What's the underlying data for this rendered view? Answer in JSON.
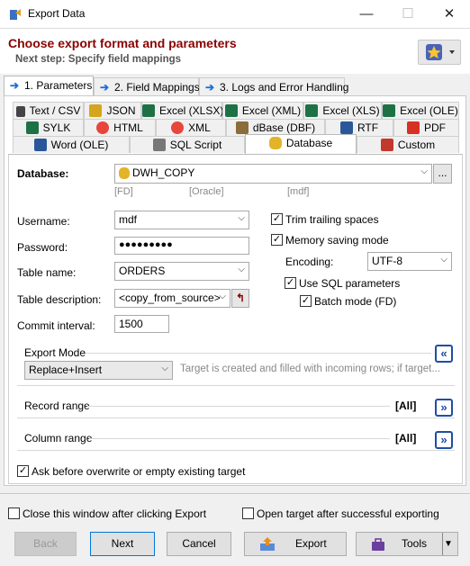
{
  "window": {
    "title": "Export Data",
    "minimize": "—",
    "maximize": "☐",
    "close": "✕"
  },
  "header": {
    "title": "Choose export format and parameters",
    "subtitle": "Next step: Specify field mappings"
  },
  "main_tabs": [
    {
      "label": "1. Parameters",
      "active": true
    },
    {
      "label": "2. Field Mappings",
      "active": false
    },
    {
      "label": "3. Logs and Error Handling",
      "active": false
    }
  ],
  "format_tabs": {
    "row1": [
      "Text / CSV",
      "JSON",
      "Excel (XLSX)",
      "Excel (XML)",
      "Excel (XLS)",
      "Excel (OLE)"
    ],
    "row2": [
      "SYLK",
      "HTML",
      "XML",
      "dBase (DBF)",
      "RTF",
      "PDF"
    ],
    "row3": [
      "Word (OLE)",
      "SQL Script",
      "Database",
      "Custom"
    ],
    "active": "Database"
  },
  "form": {
    "database_label": "Database:",
    "database_value": "DWH_COPY",
    "database_hints": [
      "[FD]",
      "[Oracle]",
      "[mdf]"
    ],
    "browse": "...",
    "username_label": "Username:",
    "username_value": "mdf",
    "password_label": "Password:",
    "password_value": "●●●●●●●●●",
    "table_name_label": "Table name:",
    "table_name_value": "ORDERS",
    "table_desc_label": "Table description:",
    "table_desc_value": "<copy_from_source>",
    "commit_label": "Commit interval:",
    "commit_value": "1500",
    "trim_label": "Trim trailing spaces",
    "trim_checked": true,
    "memory_label": "Memory saving mode",
    "memory_checked": true,
    "encoding_label": "Encoding:",
    "encoding_value": "UTF-8",
    "use_sql_label": "Use SQL parameters",
    "use_sql_checked": true,
    "batch_label": "Batch mode (FD)",
    "batch_checked": true
  },
  "export_mode": {
    "title": "Export Mode",
    "value": "Replace+Insert",
    "description": "Target is created and filled with incoming rows; if target..."
  },
  "record_range": {
    "title": "Record range",
    "value": "[All]"
  },
  "column_range": {
    "title": "Column range",
    "value": "[All]"
  },
  "ask_overwrite": {
    "label": "Ask before overwrite or empty existing target",
    "checked": true
  },
  "footer": {
    "close_after_label": "Close this window after clicking Export",
    "close_after_checked": false,
    "open_target_label": "Open target after successful exporting",
    "open_target_checked": false
  },
  "buttons": {
    "back": "Back",
    "next": "Next",
    "cancel": "Cancel",
    "export": "Export",
    "tools": "Tools"
  },
  "colors": {
    "title_red": "#8b0000",
    "accent_blue": "#1f4ea3",
    "focus_blue": "#0078d7"
  }
}
